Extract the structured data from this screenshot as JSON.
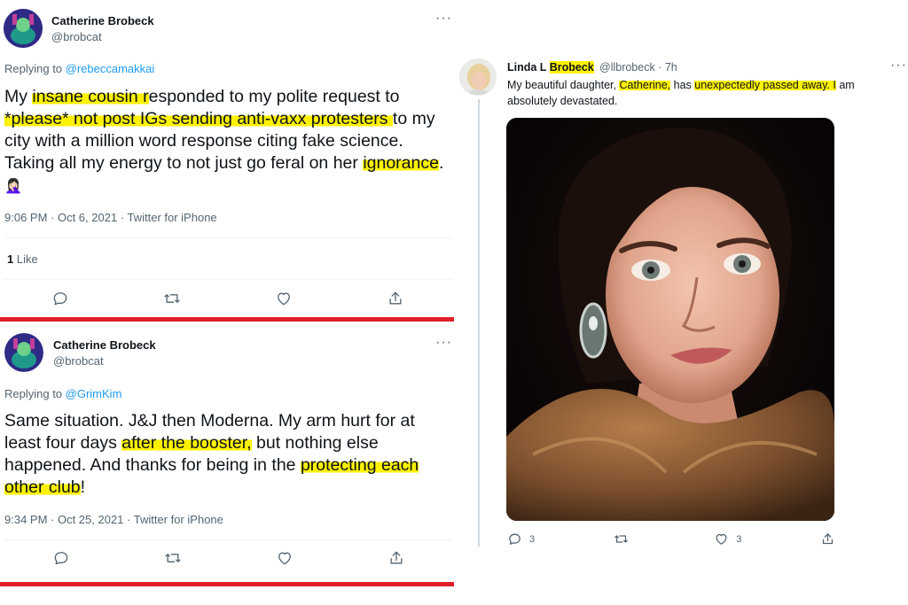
{
  "tweet1": {
    "name": "Catherine Brobeck",
    "handle": "@brobcat",
    "more": "···",
    "replying_prefix": "Replying to ",
    "replying_to": "@rebeccamakkai",
    "text_parts": [
      "My ",
      "insane cousin r",
      "esponded to my polite request to ",
      "*please* not post IGs sending anti-vaxx protesters ",
      "to my city with a million word response citing fake science. Taking all my energy to not just go feral on her ",
      "ignorance",
      ". "
    ],
    "emoji": "🤦🏻‍♀️",
    "timestamp": "9:06 PM · Oct 6, 2021 · Twitter for iPhone",
    "likes_count": "1",
    "likes_label": " Like"
  },
  "tweet2": {
    "name": "Catherine Brobeck",
    "handle": "@brobcat",
    "more": "···",
    "replying_prefix": "Replying to ",
    "replying_to": "@GrimKim",
    "text_parts": [
      "Same situation. J&J then Moderna. My arm hurt for at least four days ",
      "after the booster,",
      " but nothing else happened. And thanks for being in the ",
      "protecting each other club",
      "!"
    ],
    "timestamp": "9:34 PM · Oct 25, 2021 · Twitter for iPhone"
  },
  "tweet3": {
    "name_parts": [
      "Linda L ",
      "Brobeck"
    ],
    "handle": "@llbrobeck · 7h",
    "more": "···",
    "text_parts": [
      "My beautiful daughter, ",
      "Catherine,",
      " has ",
      "unexpectedly passed away. I",
      " am absolutely devastated."
    ],
    "reply_count": "3",
    "retweet_count": "",
    "like_count": "3",
    "share_count": ""
  },
  "colors": {
    "highlight": "#fff200",
    "link": "#1d9bf0",
    "red_divider": "#e0202a",
    "muted": "#536471"
  },
  "icons": [
    "reply-icon",
    "retweet-icon",
    "like-icon",
    "share-icon",
    "more-icon"
  ]
}
